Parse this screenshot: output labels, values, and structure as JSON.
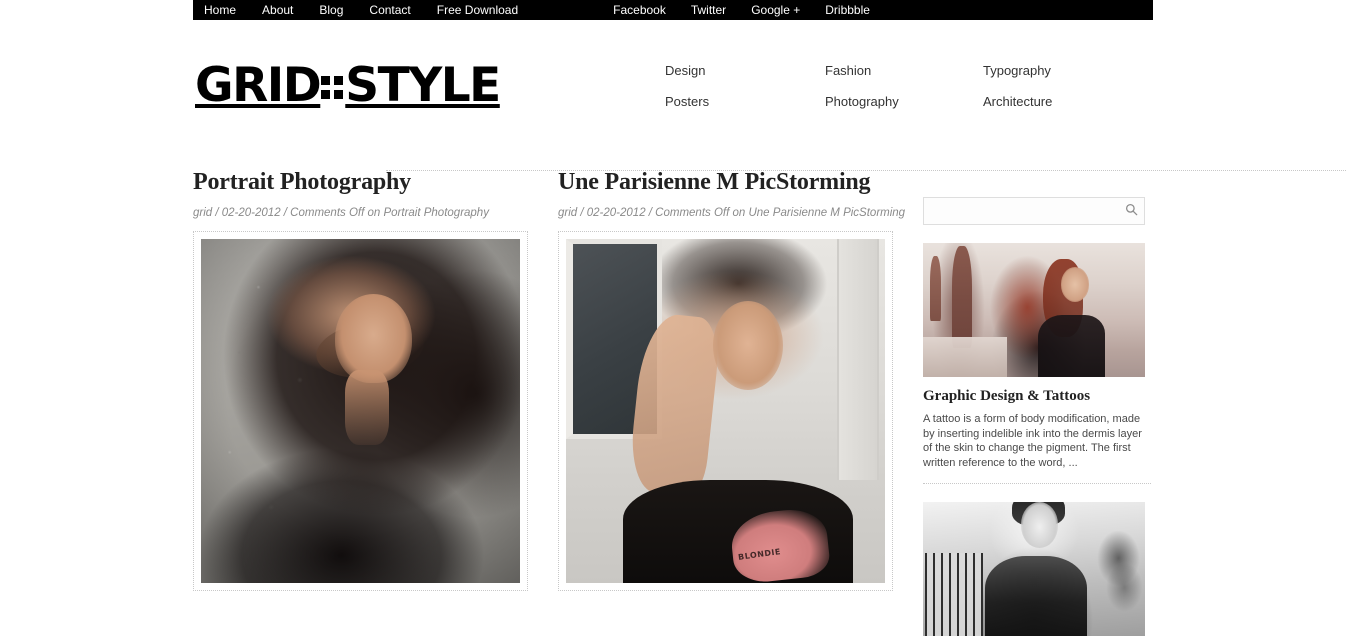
{
  "topbar": {
    "nav": [
      {
        "label": "Home"
      },
      {
        "label": "About"
      },
      {
        "label": "Blog"
      },
      {
        "label": "Contact"
      },
      {
        "label": "Free Download"
      }
    ],
    "social": [
      {
        "label": "Facebook"
      },
      {
        "label": "Twitter"
      },
      {
        "label": "Google +"
      },
      {
        "label": "Dribbble"
      }
    ],
    "background_color": "#000000",
    "text_color": "#ffffff"
  },
  "header": {
    "logo": {
      "part1": "GRID",
      "separator": "::",
      "part2": "STYLE"
    },
    "categories": [
      {
        "label": "Design"
      },
      {
        "label": "Fashion"
      },
      {
        "label": "Typography"
      },
      {
        "label": "Posters"
      },
      {
        "label": "Photography"
      },
      {
        "label": "Architecture"
      }
    ]
  },
  "posts": [
    {
      "title": "Portrait Photography",
      "meta": "grid / 02-20-2012 / Comments Off on Portrait Photography",
      "author": "grid",
      "date": "02-20-2012",
      "comments": "Comments Off on Portrait Photography",
      "image_alt": "Portrait of a dark-haired woman in a black leather jacket against a concrete wall"
    },
    {
      "title": "Une Parisienne M PicStorming",
      "meta": "grid / 02-20-2012 / Comments Off on Une Parisienne M PicStorming",
      "author": "grid",
      "date": "02-20-2012",
      "comments": "Comments Off on Une Parisienne M PicStorming",
      "image_alt": "Woman with hand on forehead wearing a black Blondie t-shirt in front of a white panelled door",
      "tee_text": "BLONDIE"
    }
  ],
  "sidebar": {
    "search": {
      "value": "",
      "placeholder": "",
      "icon": "search-icon"
    },
    "widgets": [
      {
        "title": "Graphic Design & Tattoos",
        "excerpt": "A tattoo is a form of body modification, made by inserting indelible ink into the dermis layer of the skin to change the pigment. The first written reference to the word, ...",
        "image_alt": "Red-haired tattooed woman standing on a Paris bridge with ornate lamp posts"
      },
      {
        "title": "",
        "excerpt": "",
        "image_alt": "Black and white photo of a woman in a sheer black top on a balcony"
      }
    ]
  },
  "colors": {
    "page_background": "#ffffff",
    "topbar": "#000000",
    "heading": "#222222",
    "meta_text": "#8a8a8a",
    "body_text": "#4a4a4a",
    "divider": "#c8c8c8",
    "input_border": "#dedede"
  }
}
